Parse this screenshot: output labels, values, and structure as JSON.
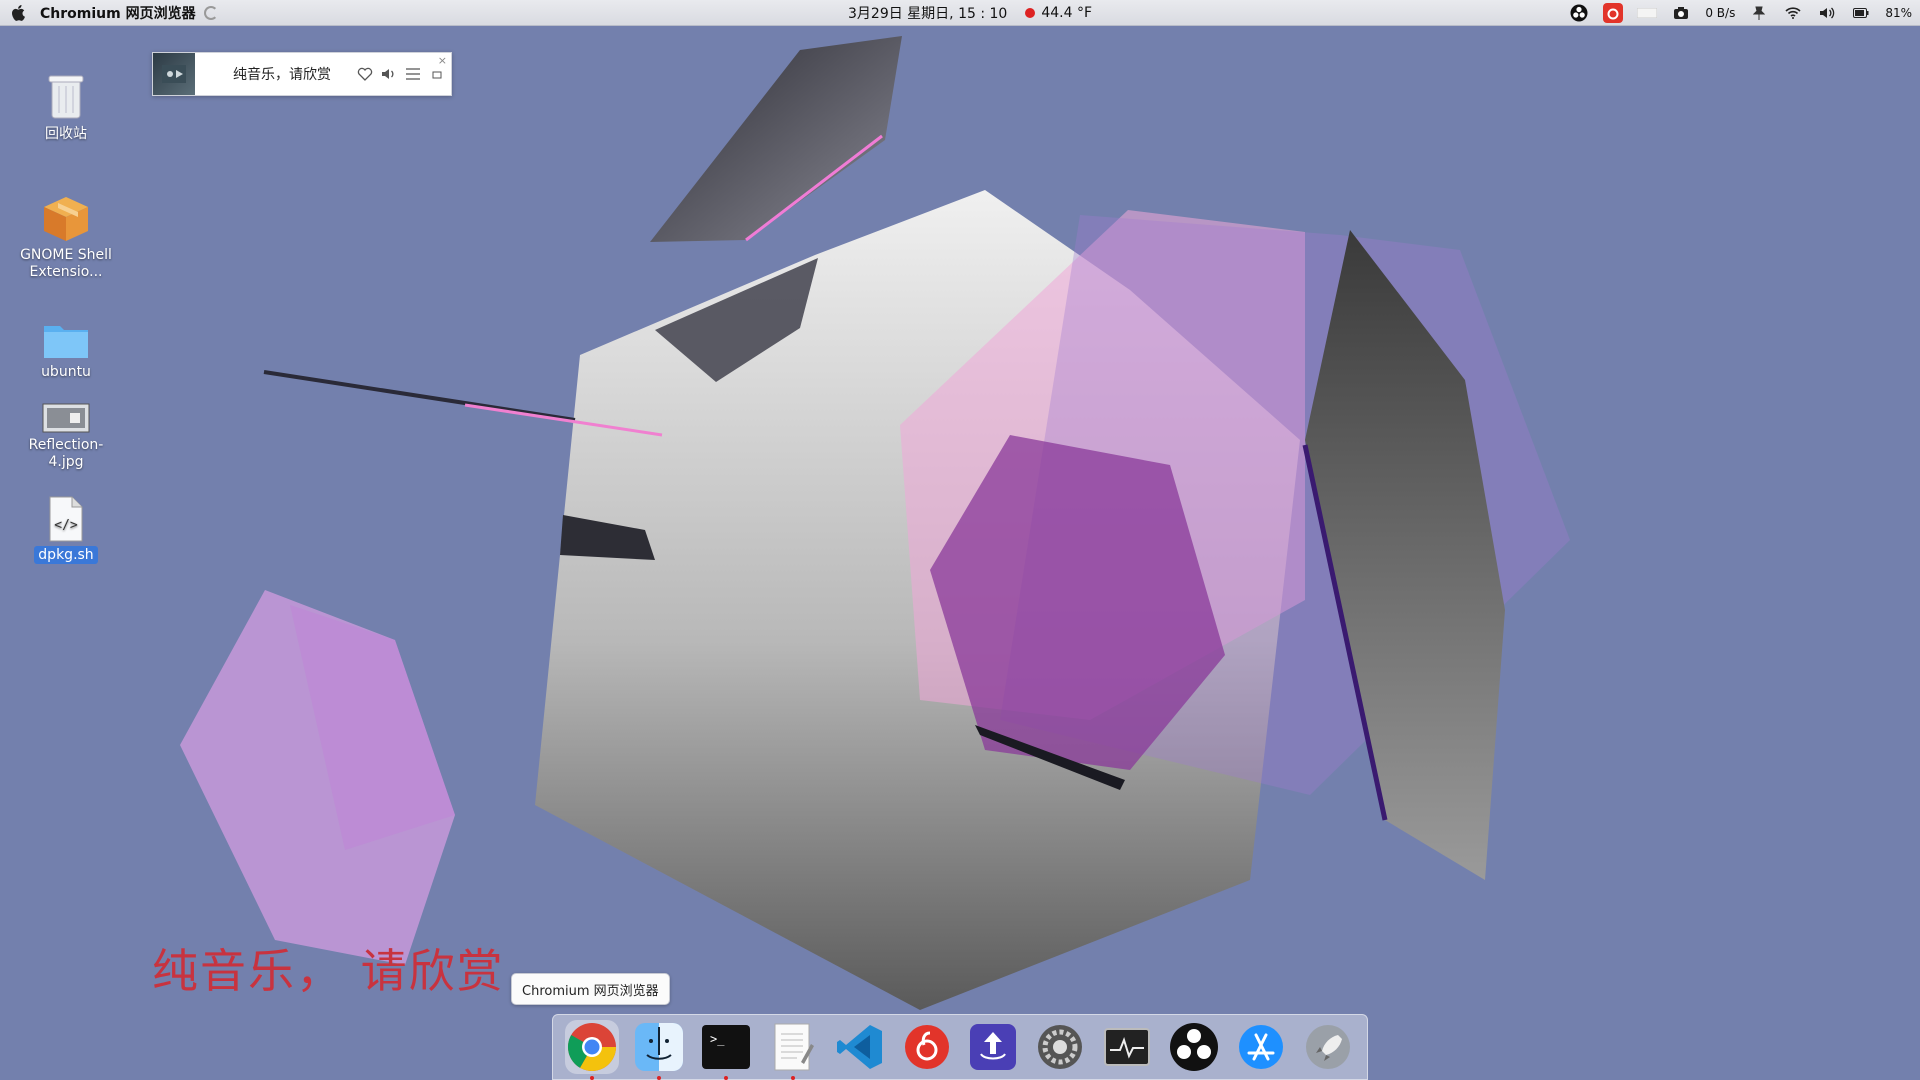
{
  "topbar": {
    "app_name": "Chromium 网页浏览器",
    "datetime": "3月29日 星期日, 15 : 10",
    "weather": "44.4 °F",
    "net_speed": "0 B/s",
    "battery": "81%"
  },
  "desktop_icons": [
    {
      "label": "回收站",
      "icon": "trash-icon"
    },
    {
      "label": "GNOME Shell Extensio...",
      "icon": "package-icon"
    },
    {
      "label": "ubuntu",
      "icon": "folder-icon"
    },
    {
      "label": "Reflection-4.jpg",
      "icon": "image-file-icon"
    },
    {
      "label": "dpkg.sh",
      "icon": "script-file-icon",
      "selected": true
    }
  ],
  "music_widget": {
    "title": "纯音乐，请欣赏",
    "close_label": "×"
  },
  "lyrics": "纯音乐，  请欣赏",
  "dock": {
    "tooltip": "Chromium 网页浏览器",
    "items": [
      {
        "name": "chromium",
        "icon": "chromium-icon"
      },
      {
        "name": "finder",
        "icon": "finder-icon"
      },
      {
        "name": "terminal",
        "icon": "terminal-icon"
      },
      {
        "name": "text-editor",
        "icon": "text-editor-icon"
      },
      {
        "name": "vscode",
        "icon": "vscode-icon"
      },
      {
        "name": "netease-music",
        "icon": "netease-music-icon"
      },
      {
        "name": "upload-tool",
        "icon": "upload-icon"
      },
      {
        "name": "system-settings",
        "icon": "gear-icon"
      },
      {
        "name": "system-monitor",
        "icon": "monitor-icon"
      },
      {
        "name": "obs",
        "icon": "obs-icon"
      },
      {
        "name": "app-store",
        "icon": "app-store-icon"
      },
      {
        "name": "launchpad",
        "icon": "rocket-icon"
      }
    ]
  },
  "colors": {
    "desktop_bg": "#7380ad",
    "lyrics": "#c8333f",
    "selection": "#3a78d8"
  }
}
